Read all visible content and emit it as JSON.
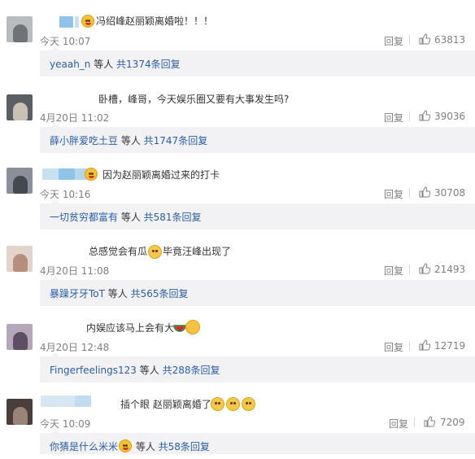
{
  "comments": [
    {
      "text": "冯绍峰赵丽颖离婚啦！！！",
      "time": "今天 10:07",
      "reply_label": "回复",
      "likes": "63813",
      "replies": {
        "user": "yeaah_n",
        "middle": " 等人 ",
        "count_label": "共1374条回复"
      }
    },
    {
      "text": "卧槽，峰哥，今天娱乐圈又要有大事发生吗?",
      "time": "4月20日 11:02",
      "reply_label": "回复",
      "likes": "39036",
      "replies": {
        "user": "薛小胖爱吃土豆",
        "middle": " 等人 ",
        "count_label": "共1747条回复"
      }
    },
    {
      "text": "因为赵丽颖离婚过来的打卡",
      "time": "今天 10:16",
      "reply_label": "回复",
      "likes": "30708",
      "replies": {
        "user": "一切贫穷都富有",
        "middle": " 等人 ",
        "count_label": "共581条回复"
      }
    },
    {
      "text_a": "总感觉会有瓜",
      "text_b": "毕竟汪峰出现了",
      "time": "4月20日 11:08",
      "reply_label": "回复",
      "likes": "21493",
      "replies": {
        "user": "暴躁牙牙ToT",
        "middle": " 等人 ",
        "count_label": "共565条回复"
      }
    },
    {
      "text": "内娱应该马上会有大",
      "time": "4月20日 12:48",
      "reply_label": "回复",
      "likes": "12719",
      "replies": {
        "user": "Fingerfeelings123",
        "middle": " 等人 ",
        "count_label": "共288条回复"
      }
    },
    {
      "text": "插个眼 赵丽颖离婚了",
      "time": "今天 10:09",
      "reply_label": "回复",
      "likes": "7209",
      "replies": {
        "user": "你猜是什么米米",
        "middle": " 等人 ",
        "count_label": "共58条回复"
      }
    }
  ],
  "colors": {
    "link": "#2a5ea6",
    "meta": "#808080",
    "reply_bg": "#f2f2f5",
    "name_blur": "#8fc3e8"
  },
  "icons": {
    "like": "thumbs-up-icon",
    "emoji": "heart-eyes-emoji-icon",
    "cat": "doge-cat-emoji-icon",
    "watermelon": "watermelon-icon",
    "ok": "ok-hand-icon"
  }
}
